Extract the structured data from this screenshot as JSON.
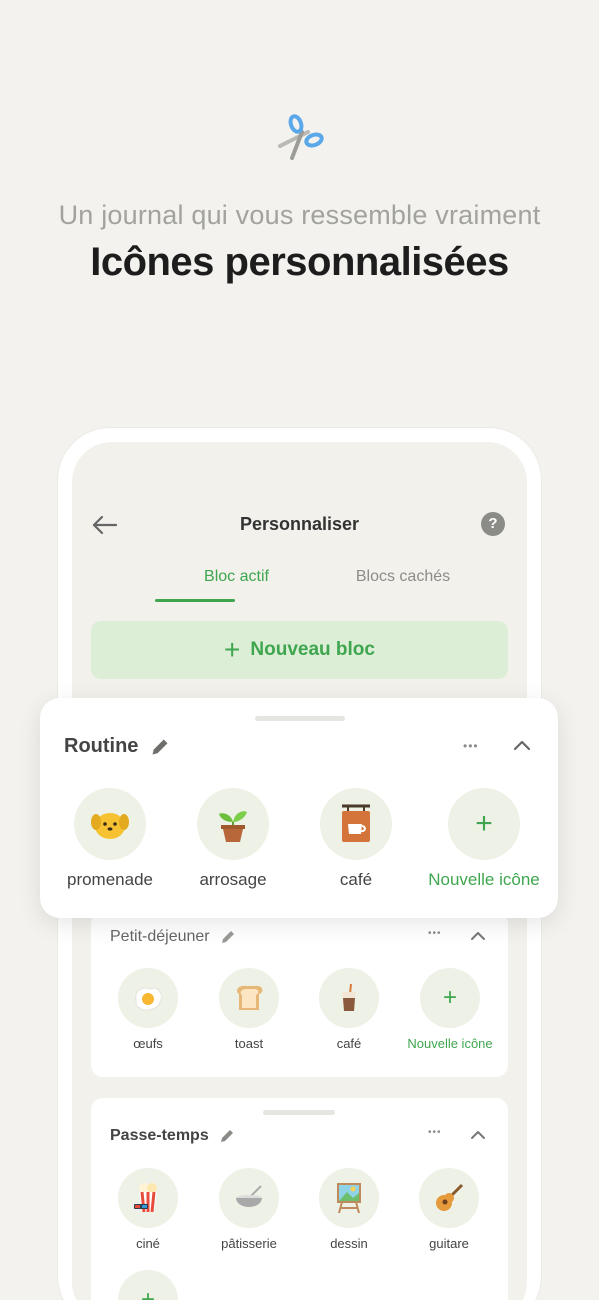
{
  "hero": {
    "icon": "scissors-icon",
    "subtitle": "Un journal qui vous ressemble vraiment",
    "headline": "Icônes personnalisées"
  },
  "screen": {
    "title": "Personnaliser",
    "help": "?",
    "tabs": {
      "active": "Bloc actif",
      "other": "Blocs cachés"
    },
    "new_block": {
      "plus": "+",
      "label": "Nouveau bloc"
    }
  },
  "routine": {
    "title": "Routine",
    "dots": "•••",
    "items": [
      {
        "label": "promenade",
        "icon": "dog-icon"
      },
      {
        "label": "arrosage",
        "icon": "plant-pot-icon"
      },
      {
        "label": "café",
        "icon": "cafe-sign-icon"
      }
    ],
    "add": {
      "plus": "+",
      "label": "Nouvelle icône"
    }
  },
  "breakfast": {
    "title": "Petit-déjeuner",
    "dots": "•••",
    "items": [
      {
        "label": "œufs",
        "icon": "egg-icon"
      },
      {
        "label": "toast",
        "icon": "toast-icon"
      },
      {
        "label": "café",
        "icon": "iced-coffee-icon"
      }
    ],
    "add": {
      "plus": "+",
      "label": "Nouvelle icône"
    }
  },
  "hobbies": {
    "title": "Passe-temps",
    "dots": "•••",
    "items": [
      {
        "label": "ciné",
        "icon": "popcorn-icon"
      },
      {
        "label": "pâtisserie",
        "icon": "mixing-bowl-icon"
      },
      {
        "label": "dessin",
        "icon": "easel-icon"
      },
      {
        "label": "guitare",
        "icon": "guitar-icon"
      }
    ],
    "add": {
      "plus": "+"
    }
  },
  "colors": {
    "accent": "#3fa64f",
    "background": "#f3f2ee",
    "icon_bg": "#eef1e6"
  }
}
